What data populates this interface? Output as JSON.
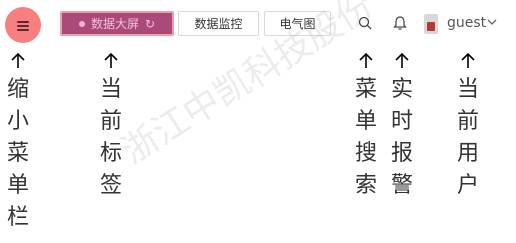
{
  "topbar": {
    "tabs": [
      {
        "label": "数据大屏",
        "active": true
      },
      {
        "label": "数据监控",
        "active": false
      },
      {
        "label": "电气图",
        "active": false
      }
    ],
    "user_name": "guest"
  },
  "annotations": {
    "collapse_menu": "缩小菜单栏",
    "current_tab": "当前标签",
    "menu_search": "菜单搜索",
    "live_alarm": "实时报警",
    "current_user": "当前用户"
  },
  "watermark": "浙江中凯科技股份",
  "colors": {
    "menu_button": "#f77f7f",
    "active_tab": "#a94a7b",
    "active_tab_border": "#f0a0a0"
  },
  "icons": [
    "menu-icon",
    "refresh-icon",
    "search-icon",
    "bell-icon",
    "chevron-down-icon",
    "arrow-up-icon"
  ]
}
